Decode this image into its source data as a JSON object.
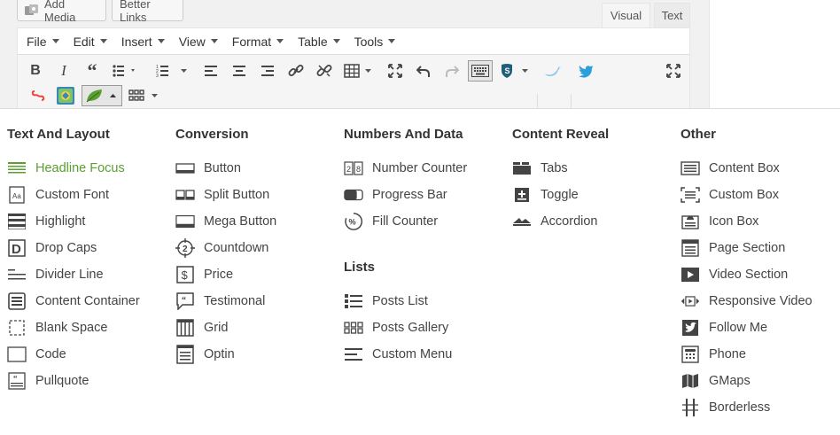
{
  "top": {
    "add_media": "Add Media",
    "better_links": "Better Links",
    "tab_visual": "Visual",
    "tab_text": "Text"
  },
  "menubar": [
    "File",
    "Edit",
    "Insert",
    "View",
    "Format",
    "Table",
    "Tools"
  ],
  "toolbar_icons": [
    "bold-icon",
    "italic-icon",
    "blockquote-icon",
    "bullet-list-icon",
    "numbered-list-icon",
    "align-left-icon",
    "align-center-icon",
    "align-right-icon",
    "link-icon",
    "unlink-icon",
    "table-icon",
    "fullscreen-icon",
    "undo-icon",
    "redo-icon",
    "keyboard-icon",
    "shield-icon",
    "tweet-icon",
    "twitter-icon",
    "expand-icon",
    "shortcode-icon",
    "image-plugin-icon",
    "leaf-icon",
    "grid-icon"
  ],
  "columns": [
    {
      "title": "Text And Layout",
      "items": [
        {
          "label": "Headline Focus",
          "icon": "headline-icon",
          "active": true
        },
        {
          "label": "Custom Font",
          "icon": "custom-font-icon"
        },
        {
          "label": "Highlight",
          "icon": "highlight-icon"
        },
        {
          "label": "Drop Caps",
          "icon": "drop-caps-icon"
        },
        {
          "label": "Divider Line",
          "icon": "divider-icon"
        },
        {
          "label": "Content Container",
          "icon": "content-container-icon"
        },
        {
          "label": "Blank Space",
          "icon": "blank-space-icon"
        },
        {
          "label": "Code",
          "icon": "code-icon"
        },
        {
          "label": "Pullquote",
          "icon": "pullquote-icon"
        }
      ]
    },
    {
      "title": "Conversion",
      "items": [
        {
          "label": "Button",
          "icon": "button-icon"
        },
        {
          "label": "Split Button",
          "icon": "split-button-icon"
        },
        {
          "label": "Mega Button",
          "icon": "mega-button-icon"
        },
        {
          "label": "Countdown",
          "icon": "countdown-icon"
        },
        {
          "label": "Price",
          "icon": "price-icon"
        },
        {
          "label": "Testimonal",
          "icon": "testimonial-icon"
        },
        {
          "label": "Grid",
          "icon": "grid-layout-icon"
        },
        {
          "label": "Optin",
          "icon": "optin-icon"
        }
      ]
    },
    {
      "title": "Numbers And Data",
      "items": [
        {
          "label": "Number Counter",
          "icon": "number-counter-icon"
        },
        {
          "label": "Progress Bar",
          "icon": "progress-bar-icon"
        },
        {
          "label": "Fill Counter",
          "icon": "fill-counter-icon"
        }
      ],
      "title2": "Lists",
      "items2": [
        {
          "label": "Posts List",
          "icon": "posts-list-icon"
        },
        {
          "label": "Posts Gallery",
          "icon": "posts-gallery-icon"
        },
        {
          "label": "Custom Menu",
          "icon": "custom-menu-icon"
        }
      ]
    },
    {
      "title": "Content Reveal",
      "items": [
        {
          "label": "Tabs",
          "icon": "tabs-icon"
        },
        {
          "label": "Toggle",
          "icon": "toggle-icon"
        },
        {
          "label": "Accordion",
          "icon": "accordion-icon"
        }
      ]
    },
    {
      "title": "Other",
      "items": [
        {
          "label": "Content Box",
          "icon": "content-box-icon"
        },
        {
          "label": "Custom Box",
          "icon": "custom-box-icon"
        },
        {
          "label": "Icon Box",
          "icon": "icon-box-icon"
        },
        {
          "label": "Page Section",
          "icon": "page-section-icon"
        },
        {
          "label": "Video Section",
          "icon": "video-section-icon"
        },
        {
          "label": "Responsive Video",
          "icon": "responsive-video-icon"
        },
        {
          "label": "Follow Me",
          "icon": "follow-me-icon"
        },
        {
          "label": "Phone",
          "icon": "phone-icon"
        },
        {
          "label": "GMaps",
          "icon": "gmaps-icon"
        },
        {
          "label": "Borderless",
          "icon": "borderless-icon"
        }
      ]
    }
  ],
  "colors": {
    "accent_green": "#5b9e32",
    "twitter_blue": "#2b9fd9",
    "shield_teal": "#1f5f7a"
  }
}
